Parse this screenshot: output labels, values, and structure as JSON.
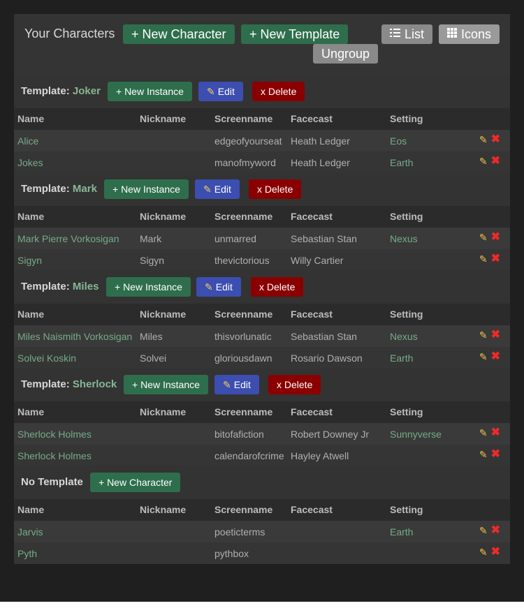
{
  "header": {
    "title": "Your Characters",
    "new_character": "+ New Character",
    "new_template": "+ New Template",
    "list": "List",
    "icons": "Icons",
    "ungroup": "Ungroup"
  },
  "columns": [
    "Name",
    "Nickname",
    "Screenname",
    "Facecast",
    "Setting"
  ],
  "buttons": {
    "new_instance": "+ New Instance",
    "edit": "Edit",
    "delete": "x Delete",
    "new_character": "+ New Character"
  },
  "groups": [
    {
      "label": "Template:",
      "name": "Joker",
      "rows": [
        {
          "name": "Alice",
          "nickname": "",
          "screenname": "edgeofyourseat",
          "facecast": "Heath Ledger",
          "setting": "Eos"
        },
        {
          "name": "Jokes",
          "nickname": "",
          "screenname": "manofmyword",
          "facecast": "Heath Ledger",
          "setting": "Earth"
        }
      ]
    },
    {
      "label": "Template:",
      "name": "Mark",
      "rows": [
        {
          "name": "Mark Pierre Vorkosigan",
          "nickname": "Mark",
          "screenname": "unmarred",
          "facecast": "Sebastian Stan",
          "setting": "Nexus"
        },
        {
          "name": "Sigyn",
          "nickname": "Sigyn",
          "screenname": "thevictorious",
          "facecast": "Willy Cartier",
          "setting": ""
        }
      ]
    },
    {
      "label": "Template:",
      "name": "Miles",
      "rows": [
        {
          "name": "Miles Naismith Vorkosigan",
          "nickname": "Miles",
          "screenname": "thisvorlunatic",
          "facecast": "Sebastian Stan",
          "setting": "Nexus"
        },
        {
          "name": "Solvei Koskin",
          "nickname": "Solvei",
          "screenname": "gloriousdawn",
          "facecast": "Rosario Dawson",
          "setting": "Earth"
        }
      ]
    },
    {
      "label": "Template:",
      "name": "Sherlock",
      "rows": [
        {
          "name": "Sherlock Holmes",
          "nickname": "",
          "screenname": "bitofafiction",
          "facecast": "Robert Downey Jr",
          "setting": "Sunnyverse"
        },
        {
          "name": "Sherlock Holmes",
          "nickname": "",
          "screenname": "calendarofcrime",
          "facecast": "Hayley Atwell",
          "setting": ""
        }
      ]
    },
    {
      "label": "No Template",
      "name": "",
      "rows": [
        {
          "name": "Jarvis",
          "nickname": "",
          "screenname": "poeticterms",
          "facecast": "",
          "setting": "Earth"
        },
        {
          "name": "Pyth",
          "nickname": "",
          "screenname": "pythbox",
          "facecast": "",
          "setting": ""
        }
      ]
    }
  ],
  "icons": {
    "edit": "pencil-icon",
    "delete": "x-icon",
    "list": "list-icon",
    "grid": "grid-icon"
  },
  "colors": {
    "green": "#2e6e4c",
    "blue": "#3c4eb0",
    "red": "#8a0000",
    "link": "#76ab86",
    "delete_icon": "#ee2a2a"
  }
}
